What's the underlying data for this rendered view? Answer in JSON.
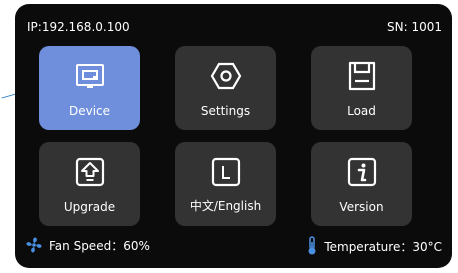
{
  "header": {
    "ip": "IP:192.168.0.100",
    "sn": "SN: 1001"
  },
  "tiles": [
    {
      "label": "Device",
      "icon": "device-icon",
      "active": true
    },
    {
      "label": "Settings",
      "icon": "settings-icon",
      "active": false
    },
    {
      "label": "Load",
      "icon": "load-icon",
      "active": false
    },
    {
      "label": "Upgrade",
      "icon": "upgrade-icon",
      "active": false
    },
    {
      "label": "中文/English",
      "icon": "language-icon",
      "active": false
    },
    {
      "label": "Version",
      "icon": "info-icon",
      "active": false
    }
  ],
  "status": {
    "fan_speed": "Fan Speed：60%",
    "temperature": "Temperature：30°C"
  },
  "colors": {
    "active_tile": "#6f8fdc",
    "tile": "#333333",
    "background": "#0b0b0b",
    "fan_icon": "#4a90e2",
    "thermometer_icon": "#4a90e2"
  }
}
